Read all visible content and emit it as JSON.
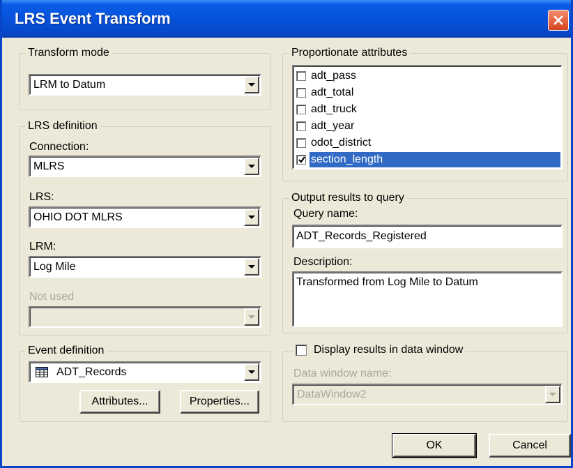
{
  "window": {
    "title": "LRS Event Transform"
  },
  "transform_mode": {
    "legend": "Transform mode",
    "value": "LRM to Datum"
  },
  "lrs_definition": {
    "legend": "LRS definition",
    "connection_label": "Connection:",
    "connection_value": "MLRS",
    "lrs_label": "LRS:",
    "lrs_value": "OHIO DOT MLRS",
    "lrm_label": "LRM:",
    "lrm_value": "Log Mile",
    "not_used_label": "Not used",
    "not_used_value": ""
  },
  "event_definition": {
    "legend": "Event definition",
    "value": "ADT_Records",
    "attributes_button": "Attributes...",
    "properties_button": "Properties..."
  },
  "proportionate_attributes": {
    "legend": "Proportionate attributes",
    "items": [
      {
        "label": "adt_pass",
        "checked": false,
        "selected": false
      },
      {
        "label": "adt_total",
        "checked": false,
        "selected": false
      },
      {
        "label": "adt_truck",
        "checked": false,
        "selected": false
      },
      {
        "label": "adt_year",
        "checked": false,
        "selected": false
      },
      {
        "label": "odot_district",
        "checked": false,
        "selected": false
      },
      {
        "label": "section_length",
        "checked": true,
        "selected": true
      }
    ]
  },
  "output_results": {
    "legend": "Output results to query",
    "query_name_label": "Query name:",
    "query_name_value": "ADT_Records_Registered",
    "description_label": "Description:",
    "description_value": "Transformed from Log Mile to Datum"
  },
  "display_results": {
    "label": "Display results in data window",
    "checked": false,
    "data_window_label": "Data window name:",
    "data_window_value": "DataWindow2"
  },
  "buttons": {
    "ok": "OK",
    "cancel": "Cancel"
  },
  "colors": {
    "titlebar": "#0752da",
    "selection": "#316ac5",
    "face": "#ece9d8"
  }
}
